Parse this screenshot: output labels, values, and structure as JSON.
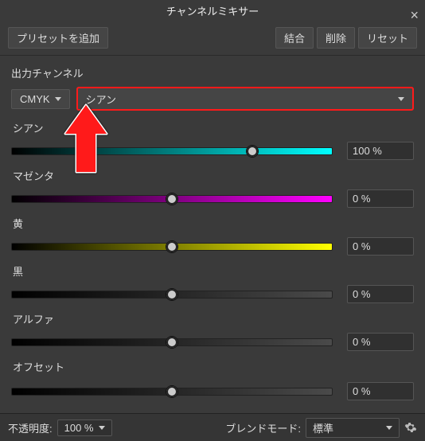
{
  "title": "チャンネルミキサー",
  "toolbar": {
    "add_preset": "プリセットを追加",
    "merge": "結合",
    "delete": "削除",
    "reset": "リセット"
  },
  "output_section": {
    "label": "出力チャンネル",
    "mode": "CMYK",
    "channel": "シアン"
  },
  "sliders": [
    {
      "key": "cyan",
      "label": "シアン",
      "value": "100 %",
      "pos": 75,
      "gradient": "grad-cyan"
    },
    {
      "key": "magenta",
      "label": "マゼンタ",
      "value": "0 %",
      "pos": 50,
      "gradient": "grad-mag"
    },
    {
      "key": "yellow",
      "label": "黄",
      "value": "0 %",
      "pos": 50,
      "gradient": "grad-yel"
    },
    {
      "key": "black",
      "label": "黒",
      "value": "0 %",
      "pos": 50,
      "gradient": "grad-blk"
    },
    {
      "key": "alpha",
      "label": "アルファ",
      "value": "0 %",
      "pos": 50,
      "gradient": "grad-alp"
    }
  ],
  "offset": {
    "label": "オフセット",
    "value": "0 %",
    "pos": 50,
    "gradient": "grad-off"
  },
  "bottom": {
    "opacity_label": "不透明度:",
    "opacity_value": "100 %",
    "blend_label": "ブレンドモード:",
    "blend_value": "標準"
  }
}
